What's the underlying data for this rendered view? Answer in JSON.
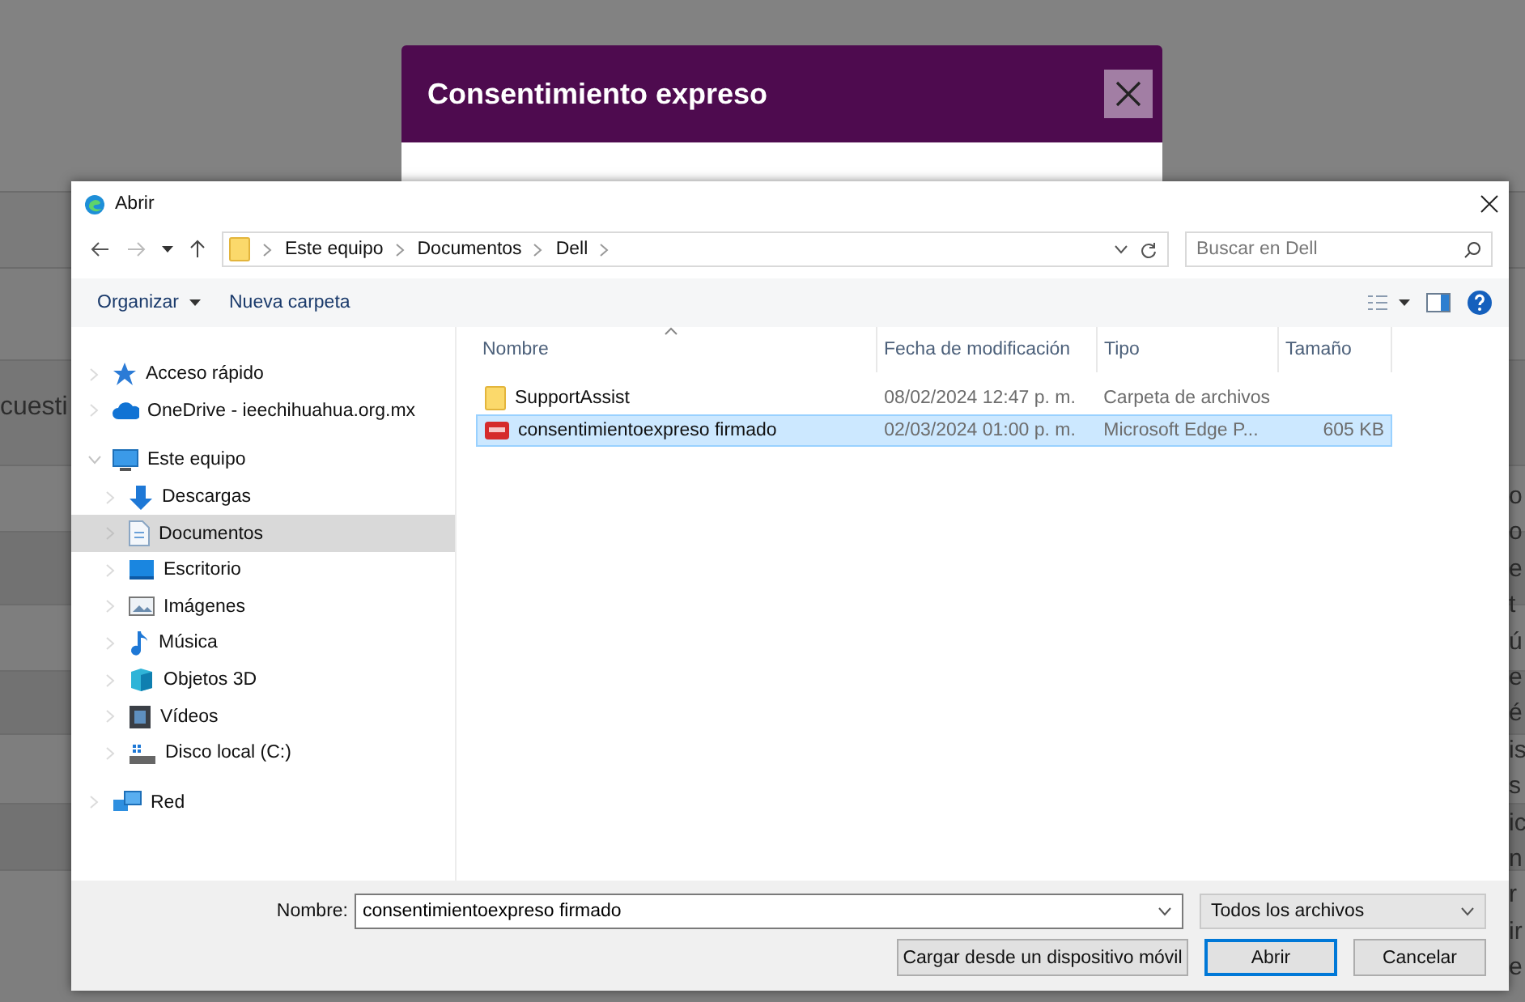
{
  "background": {
    "left_text": "cuesti",
    "right_fragments": [
      "o",
      "o",
      "e",
      "t",
      "ú",
      "e",
      "é",
      "is",
      "s",
      "ic",
      "n",
      "r",
      "ir",
      "e"
    ]
  },
  "modal": {
    "title": "Consentimiento expreso"
  },
  "dialog": {
    "title": "Abrir",
    "path": [
      "Este equipo",
      "Documentos",
      "Dell"
    ],
    "search": {
      "placeholder": "Buscar en Dell"
    },
    "toolbar": [
      {
        "label": "Organizar",
        "menu": true
      },
      {
        "label": "Nueva carpeta",
        "menu": false
      }
    ],
    "nav": [
      {
        "label": "Acceso rápido",
        "kind": "star",
        "selected": false,
        "expanded": false
      },
      {
        "label": "OneDrive - ieechihuahua.org.mx",
        "kind": "cloud",
        "selected": false,
        "expanded": false
      },
      {
        "label": "Este equipo",
        "kind": "pc",
        "selected": false,
        "expanded": true,
        "children": [
          {
            "label": "Descargas",
            "kind": "download",
            "selected": false
          },
          {
            "label": "Documentos",
            "kind": "doc",
            "selected": true
          },
          {
            "label": "Escritorio",
            "kind": "desktop",
            "selected": false
          },
          {
            "label": "Imágenes",
            "kind": "image",
            "selected": false
          },
          {
            "label": "Música",
            "kind": "music",
            "selected": false
          },
          {
            "label": "Objetos 3D",
            "kind": "cube",
            "selected": false
          },
          {
            "label": "Vídeos",
            "kind": "video",
            "selected": false
          },
          {
            "label": "Disco local (C:)",
            "kind": "drive",
            "selected": false
          }
        ]
      },
      {
        "label": "Red",
        "kind": "network",
        "selected": false,
        "expanded": false
      }
    ],
    "columns": [
      "Nombre",
      "Fecha de modificación",
      "Tipo",
      "Tamaño"
    ],
    "files": [
      {
        "name": "SupportAssist",
        "date": "08/02/2024 12:47 p. m.",
        "type": "Carpeta de archivos",
        "kind": "folder",
        "selected": false
      },
      {
        "name": "consentimientoexpreso firmado",
        "date": "02/03/2024 01:00 p. m.",
        "type": "Microsoft Edge P...",
        "size": "605 KB",
        "kind": "pdf",
        "selected": true
      }
    ],
    "filename": {
      "label": "Nombre:",
      "value": "consentimientoexpreso firmado"
    },
    "filter": "Todos los archivos",
    "buttons": [
      {
        "label": "Cargar desde un dispositivo móvil",
        "default": false
      },
      {
        "label": "Abrir",
        "default": true
      },
      {
        "label": "Cancelar",
        "default": false
      }
    ]
  }
}
